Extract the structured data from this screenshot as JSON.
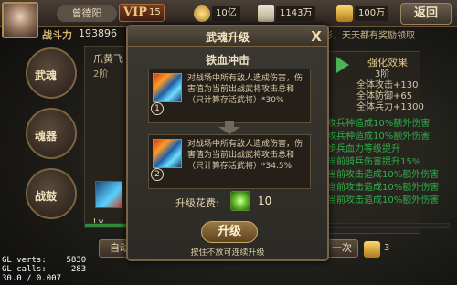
{
  "header": {
    "player_name": "曾德阳",
    "vip_label": "VIP",
    "vip_level": "15",
    "currencies": [
      {
        "icon": "coin-icon",
        "value": "10亿"
      },
      {
        "icon": "scroll-icon",
        "value": "1143万"
      },
      {
        "icon": "ingot-icon",
        "value": "100万"
      }
    ],
    "back_label": "返回",
    "power_label": "战斗力",
    "power_value": "193896",
    "marquee": "影，天天都有奖励领取"
  },
  "side_nav": [
    {
      "label": "武魂"
    },
    {
      "label": "魂器"
    },
    {
      "label": "战鼓"
    }
  ],
  "background_panel": {
    "char_name": "爪黄飞",
    "char_level": "2阶",
    "level_label": "Lv.",
    "enhance_title": "强化效果",
    "enhance_level": "3阶",
    "enhance_lines": [
      "全体攻击+130",
      "全体防御+65",
      "全体兵力+1300"
    ],
    "bg_lines": [
      "攻兵种造成10%额外伤害",
      "攻兵种造成10%额外伤害",
      "步兵血力等级提升",
      "当前骑兵伤害提升15%",
      "当前攻击造成10%额外伤害",
      "当前攻击造成10%额外伤害",
      "当前攻击造成10%额外伤害"
    ],
    "progress": 0.62,
    "auto_label": "自动",
    "once_label": "一次",
    "cost_value": "3"
  },
  "dialog": {
    "title": "武魂升级",
    "close_label": "X",
    "skill_name": "铁血冲击",
    "current": {
      "number": "1",
      "icon": "skill-icon",
      "description": "对战场中所有敌人造成伤害，伤害值为当前出战武将攻击总和（只计算存活武将）*30%"
    },
    "next": {
      "number": "2",
      "icon": "skill-icon",
      "description": "对战场中所有敌人造成伤害，伤害值为当前出战武将攻击总和（只计算存活武将）*34.5%"
    },
    "cost_label": "升级花费:",
    "cost_icon": "jade-icon",
    "cost_value": "10",
    "upgrade_label": "升级",
    "hold_hint": "按住不放可连续升级"
  },
  "debug": [
    "GL verts:    5830",
    "GL calls:     283",
    "30.0 / 0.007"
  ]
}
